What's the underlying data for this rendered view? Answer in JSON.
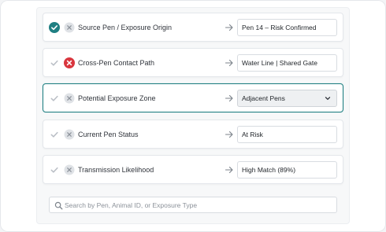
{
  "colors": {
    "accent": "#1f7f82",
    "error": "#d9363e",
    "muted_icon": "#c9ccd1"
  },
  "rows": [
    {
      "label": "Source Pen / Exposure Origin",
      "status_icon": "check-filled-teal-icon",
      "second_icon": "x-muted-icon",
      "value": "Pen 14 – Risk Confirmed",
      "is_select": false
    },
    {
      "label": "Cross-Pen Contact Path",
      "status_icon": "check-muted-icon",
      "second_icon": "x-filled-red-icon",
      "value": "Water Line | Shared Gate",
      "is_select": false
    },
    {
      "label": "Potential Exposure Zone",
      "status_icon": "check-muted-icon",
      "second_icon": "x-muted-icon",
      "value": "Adjacent Pens",
      "is_select": true
    },
    {
      "label": "Current Pen Status",
      "status_icon": "check-muted-icon",
      "second_icon": "x-muted-icon",
      "value": "At Risk",
      "is_select": false
    },
    {
      "label": "Transmission Likelihood",
      "status_icon": "check-muted-icon",
      "second_icon": "x-muted-icon",
      "value": "High Match (89%)",
      "is_select": false
    }
  ],
  "search": {
    "placeholder": "Search by Pen, Animal ID, or Exposure Type",
    "value": ""
  }
}
